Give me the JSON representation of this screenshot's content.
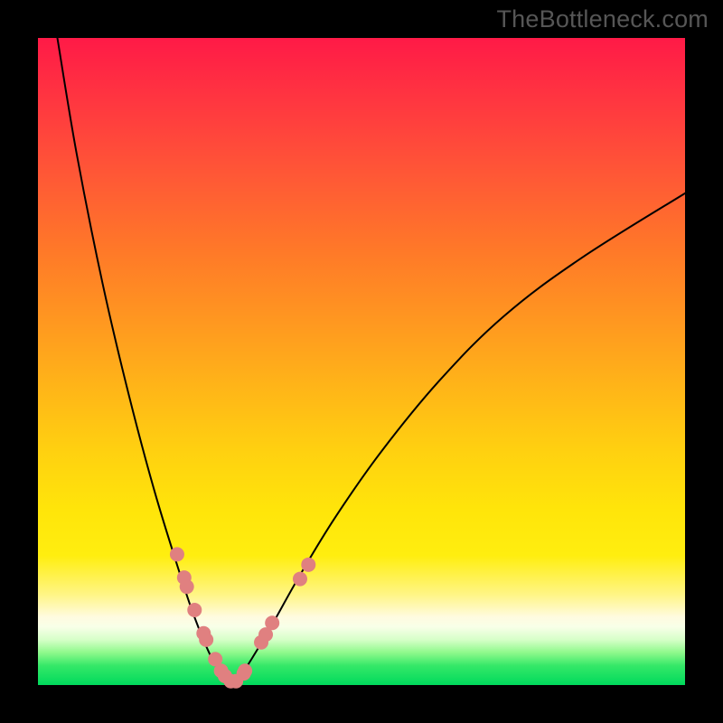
{
  "watermark": "TheBottleneck.com",
  "chart_data": {
    "type": "line",
    "title": "",
    "xlabel": "",
    "ylabel": "",
    "xlim": [
      0,
      100
    ],
    "ylim": [
      0,
      100
    ],
    "grid": false,
    "legend": "none",
    "background_gradient": {
      "direction": "vertical",
      "stops": [
        {
          "pos": 0,
          "color": "#ff1a47"
        },
        {
          "pos": 50,
          "color": "#ffb518"
        },
        {
          "pos": 80,
          "color": "#ffef0f"
        },
        {
          "pos": 90,
          "color": "#fffbe0"
        },
        {
          "pos": 100,
          "color": "#00d95c"
        }
      ]
    },
    "series": [
      {
        "name": "left-branch",
        "type": "line",
        "x": [
          3,
          6,
          10,
          14,
          18,
          22,
          24,
          26,
          27.5,
          29,
          30
        ],
        "y": [
          100,
          82,
          62,
          45,
          30,
          17,
          11,
          6,
          3,
          1,
          0
        ]
      },
      {
        "name": "right-branch",
        "type": "line",
        "x": [
          30,
          31,
          33,
          36,
          40.5,
          46,
          53,
          62,
          72,
          84,
          100
        ],
        "y": [
          0,
          1,
          4,
          9,
          17,
          26,
          36,
          47,
          57,
          66,
          76
        ]
      }
    ],
    "points": [
      {
        "x": 21.5,
        "y": 20.2
      },
      {
        "x": 22.6,
        "y": 16.6
      },
      {
        "x": 23.0,
        "y": 15.2
      },
      {
        "x": 24.2,
        "y": 11.6
      },
      {
        "x": 25.6,
        "y": 8.0
      },
      {
        "x": 26.0,
        "y": 7.0
      },
      {
        "x": 27.4,
        "y": 4.0
      },
      {
        "x": 28.3,
        "y": 2.2
      },
      {
        "x": 28.9,
        "y": 1.4
      },
      {
        "x": 29.8,
        "y": 0.6
      },
      {
        "x": 30.6,
        "y": 0.6
      },
      {
        "x": 31.8,
        "y": 1.8
      },
      {
        "x": 32.0,
        "y": 2.2
      },
      {
        "x": 34.5,
        "y": 6.6
      },
      {
        "x": 35.2,
        "y": 7.8
      },
      {
        "x": 36.2,
        "y": 9.6
      },
      {
        "x": 40.5,
        "y": 16.4
      },
      {
        "x": 41.8,
        "y": 18.6
      }
    ],
    "point_style": {
      "color": "#e08080",
      "radius_px": 8
    }
  }
}
